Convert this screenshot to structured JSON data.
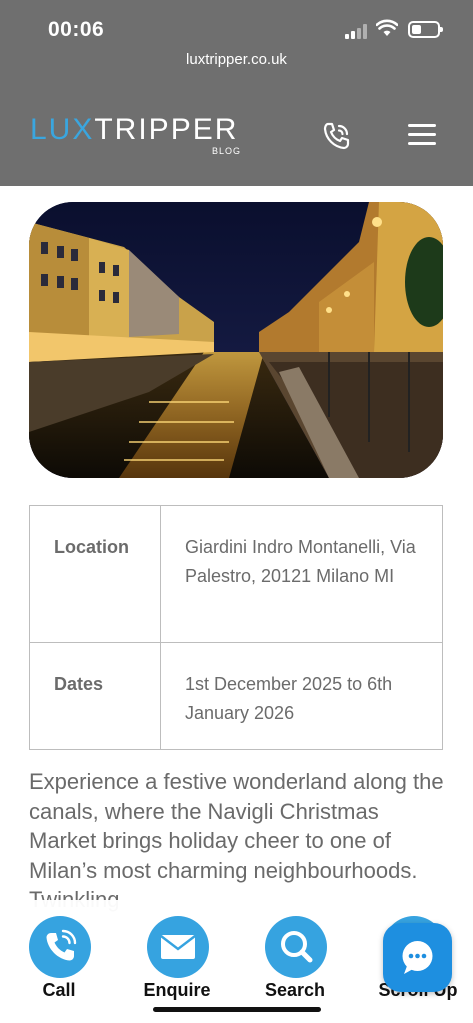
{
  "status_bar": {
    "time": "00:06"
  },
  "browser": {
    "url": "luxtripper.co.uk"
  },
  "header": {
    "logo_part1": "LUX",
    "logo_part2": "TRIPPER",
    "logo_sub": "BLOG",
    "accent_color": "#3aa6df"
  },
  "icons": {
    "phone": "phone-call-icon",
    "menu": "hamburger-menu-icon",
    "call": "phone-icon",
    "enquire": "envelope-icon",
    "search": "search-icon",
    "chat": "chat-bubble-icon"
  },
  "info": {
    "location_label": "Location",
    "location_value": "Giardini Indro Montanelli, Via Palestro, 20121 Milano MI",
    "dates_label": "Dates",
    "dates_value": "1st December 2025 to 6th January 2026"
  },
  "body": {
    "intro": "Experience a festive wonderland along the canals, where the Navigli Christmas Market brings holiday cheer to one of Milan’s most charming neighbourhoods. Twinkling"
  },
  "actions": {
    "call": "Call",
    "enquire": "Enquire",
    "search": "Search",
    "scroll_up": "Scroll Up"
  },
  "colors": {
    "fab_blue": "#36a3e0",
    "chat_blue": "#1e8fe0"
  }
}
